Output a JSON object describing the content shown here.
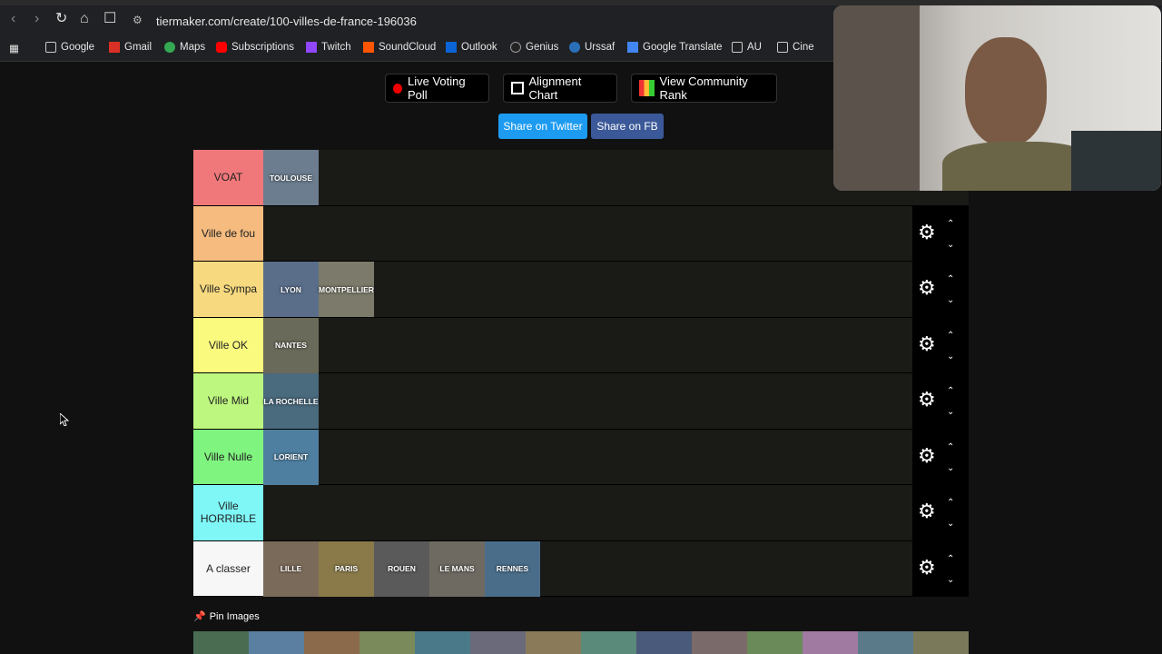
{
  "browser": {
    "url": "tiermaker.com/create/100-villes-de-france-196036",
    "bookmarks": [
      "Google",
      "Gmail",
      "Maps",
      "Subscriptions",
      "Twitch",
      "SoundCloud",
      "Outlook",
      "Genius",
      "Urssaf",
      "Google Translate",
      "AU",
      "Cine"
    ]
  },
  "toolbar": {
    "live_voting": "Live Voting Poll",
    "alignment_chart": "Alignment Chart",
    "community_rank": "View Community Rank",
    "share_twitter": "Share on Twitter",
    "share_fb": "Share on FB"
  },
  "tiers": [
    {
      "label": "VOAT",
      "color": "#f0787a",
      "items": [
        "TOULOUSE"
      ]
    },
    {
      "label": "Ville de fou",
      "color": "#f5bb7f",
      "items": []
    },
    {
      "label": "Ville Sympa",
      "color": "#f7d97f",
      "items": [
        "LYON",
        "MONTPELLIER"
      ]
    },
    {
      "label": "Ville OK",
      "color": "#fafa7f",
      "items": [
        "NANTES"
      ]
    },
    {
      "label": "Ville Mid",
      "color": "#bdf77f",
      "items": [
        "LA ROCHELLE"
      ]
    },
    {
      "label": "Ville Nulle",
      "color": "#7ff47f",
      "items": [
        "LORIENT"
      ]
    },
    {
      "label": "Ville HORRIBLE",
      "color": "#7ff7f7",
      "items": []
    },
    {
      "label": "A classer",
      "color": "#f7f7f7",
      "items": [
        "LILLE",
        "PARIS",
        "ROUEN",
        "LE MANS",
        "RENNES"
      ]
    }
  ],
  "pin_images": "Pin Images"
}
